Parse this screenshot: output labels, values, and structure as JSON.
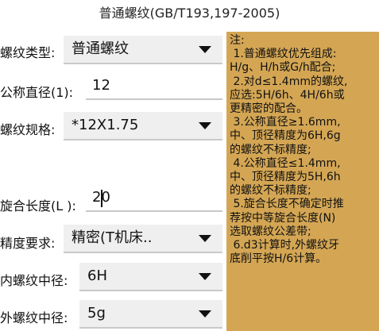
{
  "title": "普通螺纹(GB/T193,197-2005)",
  "fields": {
    "thread_type": {
      "label": "螺纹类型:",
      "value": "普通螺纹"
    },
    "nominal_diameter": {
      "label": "公称直径(1):",
      "value": "12"
    },
    "thread_spec": {
      "label": "螺纹规格:",
      "value": "*12X1.75"
    },
    "engagement_length": {
      "label": "旋合长度(L ):",
      "value": "20"
    },
    "precision": {
      "label": "精度要求:",
      "value": "精密(T机床.."
    },
    "internal_pitch_dia": {
      "label": "内螺纹中径:",
      "value": "6H"
    },
    "external_pitch_dia": {
      "label": "外螺纹中径:",
      "value": "5g"
    }
  },
  "notes": {
    "heading": "注:",
    "lines": [
      " 1.普通螺纹优先组成:",
      "H/g、H/h或G/h配合;",
      " 2.对d≤1.4mm的螺纹,",
      "应选:5H/6h、4H/6h或",
      "更精密的配合。",
      " 3.公称直径≥1.6mm,",
      "中、顶径精度为6H,6g",
      "的螺纹不标精度;",
      " 4.公称直径≤1.4mm,",
      "中、顶径精度为5H,6h",
      "的螺纹不标精度;",
      " 5.旋合长度不确定时推",
      "荐按中等旋合长度(N)",
      "选取螺纹公差带;",
      " 6.d3计算时,外螺纹牙",
      "底削平按H/6计算。"
    ]
  },
  "colors": {
    "notes_bg": "#d4a654",
    "field_underline": "#c9c9c9",
    "select_bg": "#efefef"
  },
  "icons": {
    "dropdown": "chevron-down-icon"
  }
}
